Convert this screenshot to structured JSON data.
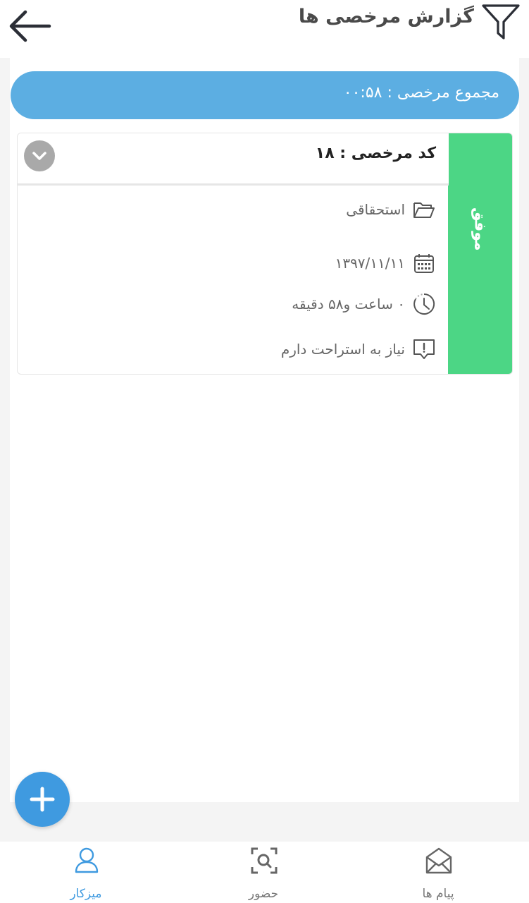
{
  "header": {
    "title": "گزارش مرخصی ها"
  },
  "summary": {
    "total_text": "مجموع مرخصی  :  ۰۰:۵۸"
  },
  "card": {
    "code_text": "کد مرخصی : ۱۸",
    "status": "موفق",
    "status_color": "#4cd685",
    "type": "استحقاقی",
    "date": "۱۳۹۷/۱۱/۱۱",
    "duration": "۰ ساعت و۵۸ دقیقه",
    "note": "نیاز به استراحت دارم"
  },
  "nav": {
    "items": [
      {
        "label": "میزکار",
        "icon": "user-icon"
      },
      {
        "label": "حضور",
        "icon": "scan-icon"
      },
      {
        "label": "پیام ها",
        "icon": "envelope-icon"
      }
    ]
  },
  "colors": {
    "accent": "#3f9ae0",
    "pill": "#5caee2",
    "success": "#4cd685"
  }
}
